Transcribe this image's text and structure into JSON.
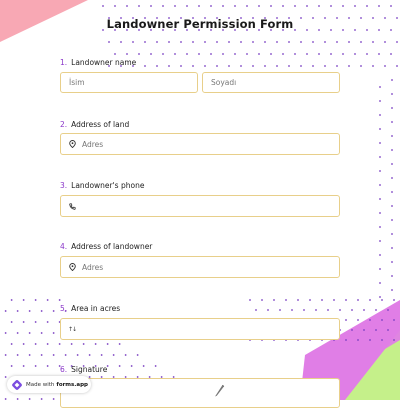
{
  "form": {
    "title": "Landowner Permission Form",
    "questions": [
      {
        "number": "1.",
        "label": "Landowner name",
        "fields": [
          {
            "placeholder": "İsim"
          },
          {
            "placeholder": "Soyadı"
          }
        ]
      },
      {
        "number": "2.",
        "label": "Address of land",
        "fields": [
          {
            "placeholder": "Adres",
            "icon": "location-pin-icon"
          }
        ]
      },
      {
        "number": "3.",
        "label": "Landowner's phone",
        "fields": [
          {
            "placeholder": "",
            "icon": "phone-icon"
          }
        ]
      },
      {
        "number": "4.",
        "label": "Address of landowner",
        "fields": [
          {
            "placeholder": "Adres",
            "icon": "location-pin-icon"
          }
        ]
      },
      {
        "number": "5.",
        "label": "Area in acres",
        "fields": [
          {
            "placeholder": "",
            "icon": "number-icon",
            "icon_text": "↑↓"
          }
        ]
      },
      {
        "number": "6.",
        "label": "Signature",
        "fields": [
          {
            "placeholder": "",
            "icon": "pen-icon"
          }
        ]
      }
    ]
  },
  "badge": {
    "made_with": "Made with",
    "brand": "forms.app"
  },
  "colors": {
    "accent": "#8a36c9",
    "field_border": "#e8cf8a",
    "corner_pink": "#f8a8b4",
    "corner_purple": "#e07ee6",
    "corner_green": "#c5f08a"
  }
}
